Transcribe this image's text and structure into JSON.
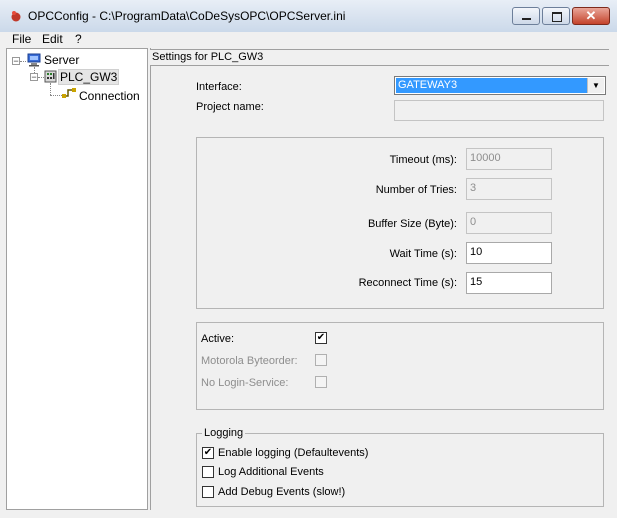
{
  "window": {
    "title": "OPCConfig - C:\\ProgramData\\CoDeSysOPC\\OPCServer.ini",
    "close_glyph": "✕"
  },
  "menu": {
    "items": [
      "File",
      "Edit",
      "?"
    ]
  },
  "tree": {
    "server": "Server",
    "plc": "PLC_GW3",
    "connection": "Connection",
    "expander_glyph": "−"
  },
  "settings": {
    "header": "Settings for PLC_GW3",
    "interface_label": "Interface:",
    "interface_value": "GATEWAY3",
    "project_name_label": "Project name:",
    "project_name_value": ""
  },
  "timing": {
    "timeout_label": "Timeout (ms):",
    "timeout_value": "10000",
    "tries_label": "Number of Tries:",
    "tries_value": "3",
    "buffer_label": "Buffer Size (Byte):",
    "buffer_value": "0",
    "wait_label": "Wait Time (s):",
    "wait_value": "10",
    "reconnect_label": "Reconnect Time (s):",
    "reconnect_value": "15"
  },
  "options": {
    "active_label": "Active:",
    "active_checked": true,
    "motorola_label": "Motorola Byteorder:",
    "motorola_checked": false,
    "login_label": "No Login-Service:",
    "login_checked": false
  },
  "logging": {
    "legend": "Logging",
    "enable_label": "Enable logging (Defaultevents)",
    "enable_checked": true,
    "additional_label": "Log Additional Events",
    "additional_checked": false,
    "debug_label": "Add Debug Events (slow!)",
    "debug_checked": false
  },
  "glyphs": {
    "check": "✔",
    "dropdown": "▼"
  }
}
